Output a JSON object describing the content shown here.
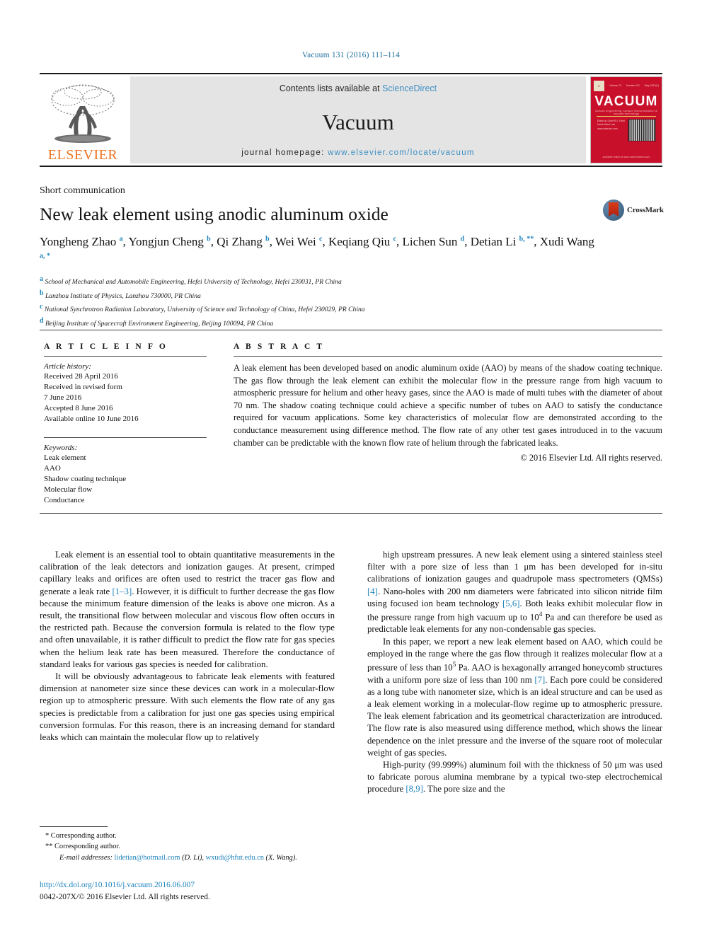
{
  "running_head": "Vacuum 131 (2016) 111–114",
  "masthead": {
    "contents_prefix": "Contents lists available at ",
    "sciencedirect": "ScienceDirect",
    "journal_name": "Vacuum",
    "homepage_label": "journal homepage: ",
    "homepage_url": "www.elsevier.com/locate/vacuum",
    "publisher_logo_text": "ELSEVIER",
    "cover": {
      "title": "VACUUM",
      "subtitle": "surface engineering, surface instrumentation & vacuum technology",
      "top_left": "Volume 79",
      "top_center": "Number 2/3",
      "top_right": "May 2015(?)",
      "left_text": "Editor-in-Chief\nR.J. Reid\nNorth-West Lab\nwww.elsevier.com",
      "bottom_text": "available online at www.sciencedirect.com"
    }
  },
  "article": {
    "section_label": "Short communication",
    "title": "New leak element using anodic aluminum oxide",
    "crossmark_label": "CrossMark",
    "authors": [
      {
        "name": "Yongheng Zhao",
        "marks": "a"
      },
      {
        "name": "Yongjun Cheng",
        "marks": "b"
      },
      {
        "name": "Qi Zhang",
        "marks": "b"
      },
      {
        "name": "Wei Wei",
        "marks": "c"
      },
      {
        "name": "Keqiang Qiu",
        "marks": "c"
      },
      {
        "name": "Lichen Sun",
        "marks": "d"
      },
      {
        "name": "Detian Li",
        "marks": "b, **"
      },
      {
        "name": "Xudi Wang",
        "marks": "a, *"
      }
    ],
    "affiliations": [
      {
        "mark": "a",
        "text": "School of Mechanical and Automobile Engineering, Hefei University of Technology, Hefei 230031, PR China"
      },
      {
        "mark": "b",
        "text": "Lanzhou Institute of Physics, Lanzhou 730000, PR China"
      },
      {
        "mark": "c",
        "text": "National Synchrotron Radiation Laboratory, University of Science and Technology of China, Hefei 230029, PR China"
      },
      {
        "mark": "d",
        "text": "Beijing Institute of Spacecraft Environment Engineering, Beijing 100094, PR China"
      }
    ]
  },
  "article_info": {
    "heading": "A R T I C L E  I N F O",
    "history_label": "Article history:",
    "history": [
      "Received 28 April 2016",
      "Received in revised form",
      "7 June 2016",
      "Accepted 8 June 2016",
      "Available online 10 June 2016"
    ],
    "keywords_label": "Keywords:",
    "keywords": [
      "Leak element",
      "AAO",
      "Shadow coating technique",
      "Molecular flow",
      "Conductance"
    ]
  },
  "abstract": {
    "heading": "A B S T R A C T",
    "text": "A leak element has been developed based on anodic aluminum oxide (AAO) by means of the shadow coating technique. The gas flow through the leak element can exhibit the molecular flow in the pressure range from high vacuum to atmospheric pressure for helium and other heavy gases, since the AAO is made of multi tubes with the diameter of about 70 nm. The shadow coating technique could achieve a specific number of tubes on AAO to satisfy the conductance required for vacuum applications. Some key characteristics of molecular flow are demonstrated according to the conductance measurement using difference method. The flow rate of any other test gases introduced in to the vacuum chamber can be predictable with the known flow rate of helium through the fabricated leaks.",
    "copyright": "© 2016 Elsevier Ltd. All rights reserved."
  },
  "body": {
    "left_paragraphs": [
      {
        "parts": [
          {
            "t": "Leak element is an essential tool to obtain quantitative measurements in the calibration of the leak detectors and ionization gauges. At present, crimped capillary leaks and orifices are often used to restrict the tracer gas flow and generate a leak rate "
          },
          {
            "t": "[1–3]",
            "ref": true
          },
          {
            "t": ". However, it is difficult to further decrease the gas flow because the minimum feature dimension of the leaks is above one micron. As a result, the transitional flow between molecular and viscous flow often occurs in the restricted path. Because the conversion formula is related to the flow type and often unavailable, it is rather difficult to predict the flow rate for gas species when the helium leak rate has been measured. Therefore the conductance of standard leaks for various gas species is needed for calibration."
          }
        ]
      },
      {
        "parts": [
          {
            "t": "It will be obviously advantageous to fabricate leak elements with featured dimension at nanometer size since these devices can work in a molecular-flow region up to atmospheric pressure. With such elements the flow rate of any gas species is predictable from a calibration for just one gas species using empirical conversion formulas. For this reason, there is an increasing demand for standard leaks which can maintain the molecular flow up to relatively"
          }
        ]
      }
    ],
    "right_paragraphs": [
      {
        "parts": [
          {
            "t": "high upstream pressures. A new leak element using a sintered stainless steel filter with a pore size of less than 1 μm has been developed for in-situ calibrations of ionization gauges and quadrupole mass spectrometers (QMSs) "
          },
          {
            "t": "[4]",
            "ref": true
          },
          {
            "t": ". Nano-holes with 200 nm diameters were fabricated into silicon nitride film using focused ion beam technology "
          },
          {
            "t": "[5,6]",
            "ref": true
          },
          {
            "t": ". Both leaks exhibit molecular flow in the pressure range from high vacuum up to 10"
          },
          {
            "t": "4",
            "sup": true
          },
          {
            "t": " Pa and can therefore be used as predictable leak elements for any non-condensable gas species."
          }
        ],
        "no_indent": false
      },
      {
        "parts": [
          {
            "t": "In this paper, we report a new leak element based on AAO, which could be employed in the range where the gas flow through it realizes molecular flow at a pressure of less than 10"
          },
          {
            "t": "5",
            "sup": true
          },
          {
            "t": " Pa. AAO is hexagonally arranged honeycomb structures with a uniform pore size of less than 100 nm "
          },
          {
            "t": "[7]",
            "ref": true
          },
          {
            "t": ". Each pore could be considered as a long tube with nanometer size, which is an ideal structure and can be used as a leak element working in a molecular-flow regime up to atmospheric pressure. The leak element fabrication and its geometrical characterization are introduced. The flow rate is also measured using difference method, which shows the linear dependence on the inlet pressure and the inverse of the square root of molecular weight of gas species."
          }
        ]
      },
      {
        "parts": [
          {
            "t": "High-purity (99.999%) aluminum foil with the thickness of 50 μm was used to fabricate porous alumina membrane by a typical two-step electrochemical procedure "
          },
          {
            "t": "[8,9]",
            "ref": true
          },
          {
            "t": ". The pore size and the"
          }
        ]
      }
    ]
  },
  "footnotes": {
    "corresponding_1": "* Corresponding author.",
    "corresponding_2": "** Corresponding author.",
    "email_label": "E-mail addresses:",
    "email_1": "lidetian@hotmail.com",
    "email_1_owner": "(D. Li),",
    "email_2": "wxudi@hfut.edu.cn",
    "email_2_owner": "(X. Wang)."
  },
  "footer": {
    "doi": "http://dx.doi.org/10.1016/j.vacuum.2016.06.007",
    "issn": "0042-207X/© 2016 Elsevier Ltd. All rights reserved."
  }
}
